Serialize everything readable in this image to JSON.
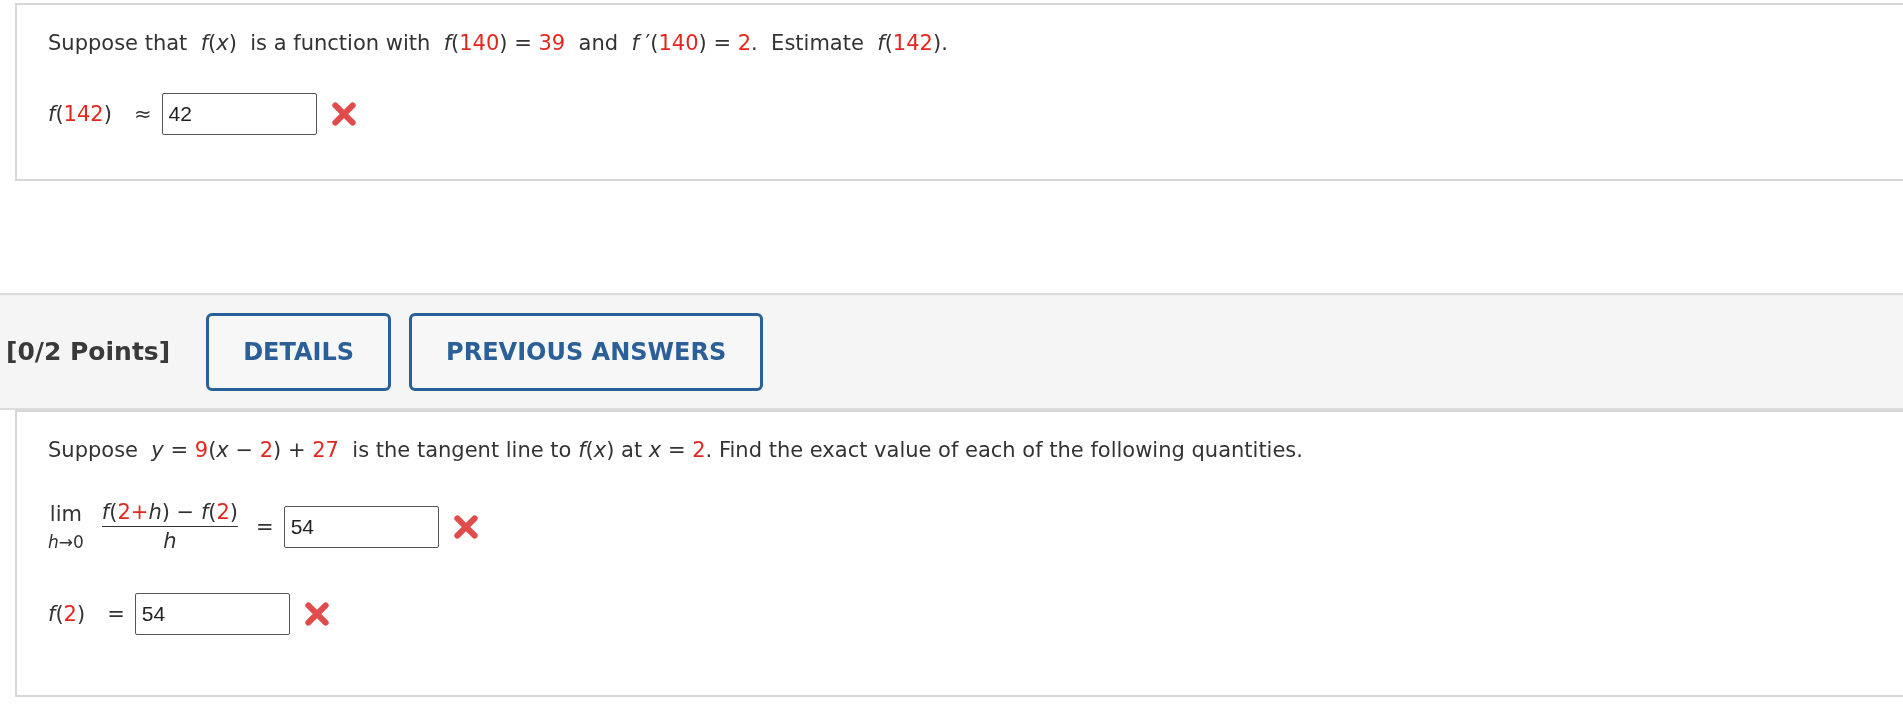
{
  "questions": [
    {
      "prompt": [
        {
          "kind": "text",
          "text": "Suppose that  *f*(*x*)  is a function with  *f*("
        },
        {
          "kind": "value",
          "text": "140"
        },
        {
          "kind": "text",
          "text": ") = "
        },
        {
          "kind": "value",
          "text": "39"
        },
        {
          "kind": "text",
          "text": "  and  *f* ′("
        },
        {
          "kind": "value",
          "text": "140"
        },
        {
          "kind": "text",
          "text": ") = "
        },
        {
          "kind": "value",
          "text": "2"
        },
        {
          "kind": "text",
          "text": ".  Estimate  *f*("
        },
        {
          "kind": "value",
          "text": "142"
        },
        {
          "kind": "text",
          "text": ")."
        }
      ],
      "answers": [
        {
          "kind": "plain",
          "label": [
            {
              "kind": "text",
              "text": "*f*("
            },
            {
              "kind": "value",
              "text": "142"
            },
            {
              "kind": "text",
              "text": ")"
            }
          ],
          "relation": "≈",
          "value": "42",
          "correct": false
        }
      ]
    },
    {
      "header": {
        "points": "[0/2 Points]",
        "buttons": [
          "DETAILS",
          "PREVIOUS ANSWERS"
        ]
      },
      "prompt": [
        {
          "kind": "text",
          "text": "Suppose  *y* = "
        },
        {
          "kind": "value",
          "text": "9"
        },
        {
          "kind": "text",
          "text": "(*x* − "
        },
        {
          "kind": "value",
          "text": "2"
        },
        {
          "kind": "text",
          "text": ") + "
        },
        {
          "kind": "value",
          "text": "27"
        },
        {
          "kind": "text",
          "text": "  is the tangent line to *f*(*x*) at *x* = "
        },
        {
          "kind": "value",
          "text": "2"
        },
        {
          "kind": "text",
          "text": ". Find the exact value of each of the following quantities."
        }
      ],
      "answers": [
        {
          "kind": "limit",
          "lim": "lim",
          "under": "h→0",
          "numerator": [
            {
              "kind": "text",
              "text": "*f*("
            },
            {
              "kind": "value",
              "text": "2+"
            },
            {
              "kind": "text",
              "text": "*h*) − *f*("
            },
            {
              "kind": "value",
              "text": "2"
            },
            {
              "kind": "text",
              "text": ")"
            }
          ],
          "denominator": "h",
          "relation": "=",
          "value": "54",
          "correct": false
        },
        {
          "kind": "plain",
          "label": [
            {
              "kind": "text",
              "text": "*f*("
            },
            {
              "kind": "value",
              "text": "2"
            },
            {
              "kind": "text",
              "text": ")"
            }
          ],
          "relation": "=",
          "value": "54",
          "correct": false
        }
      ]
    }
  ]
}
